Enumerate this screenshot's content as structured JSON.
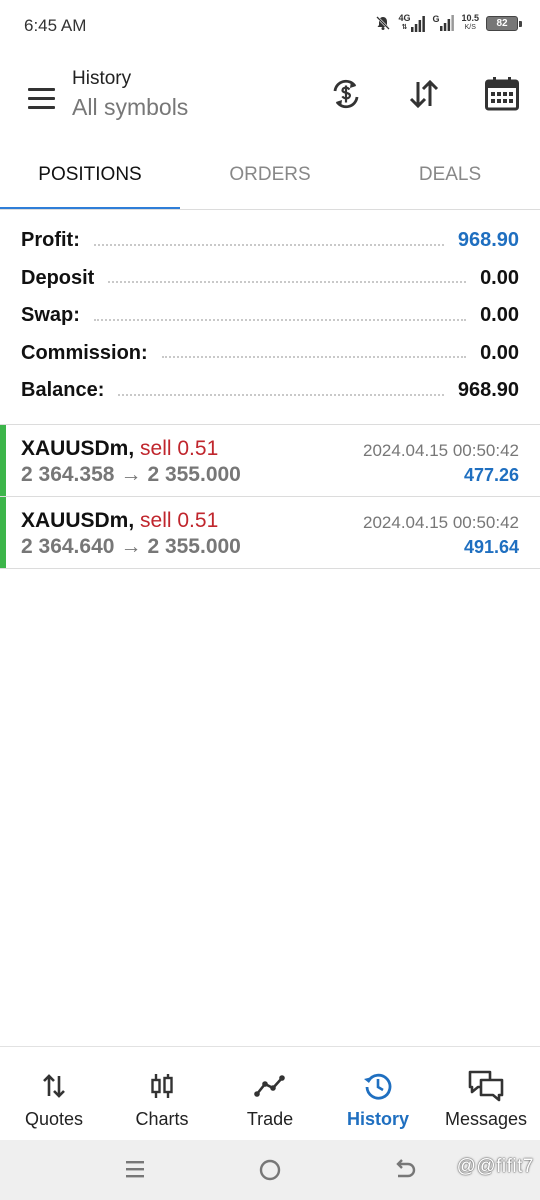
{
  "status_bar": {
    "time": "6:45 AM",
    "net1_top": "4G",
    "net1_bottom": "⇅",
    "net2": "G",
    "speed_value": "10.5",
    "speed_unit": "K/S",
    "battery": "82"
  },
  "header": {
    "title": "History",
    "subtitle": "All symbols",
    "menu_icon": "hamburger-menu-icon",
    "actions": [
      "currency-exchange-icon",
      "sort-icon",
      "calendar-icon"
    ]
  },
  "tabs": [
    {
      "label": "POSITIONS",
      "active": true
    },
    {
      "label": "ORDERS",
      "active": false
    },
    {
      "label": "DEALS",
      "active": false
    }
  ],
  "summary": [
    {
      "label": "Profit:",
      "value": "968.90",
      "color": "#1f6fc0"
    },
    {
      "label": "Deposit",
      "value": "0.00",
      "color": "#111111"
    },
    {
      "label": "Swap:",
      "value": "0.00",
      "color": "#111111"
    },
    {
      "label": "Commission:",
      "value": "0.00",
      "color": "#111111"
    },
    {
      "label": "Balance:",
      "value": "968.90",
      "color": "#111111"
    }
  ],
  "deals": [
    {
      "symbol": "XAUUSDm",
      "side": "sell 0.51",
      "open_price": "2 364.358",
      "arrow": "→",
      "close_price": "2 355.000",
      "time": "2024.04.15 00:50:42",
      "profit": "477.26"
    },
    {
      "symbol": "XAUUSDm",
      "side": "sell 0.51",
      "open_price": "2 364.640",
      "arrow": "→",
      "close_price": "2 355.000",
      "time": "2024.04.15 00:50:42",
      "profit": "491.64"
    }
  ],
  "colors": {
    "accent": "#1f6fc0",
    "tab_indicator": "#2f7ed8",
    "sell": "#c0262d",
    "profit_bar": "#3cb54a"
  },
  "bottom_nav": [
    {
      "label": "Quotes",
      "icon": "quotes-arrows-icon",
      "active": false
    },
    {
      "label": "Charts",
      "icon": "candlestick-chart-icon",
      "active": false
    },
    {
      "label": "Trade",
      "icon": "trade-line-icon",
      "active": false
    },
    {
      "label": "History",
      "icon": "history-clock-icon",
      "active": true
    },
    {
      "label": "Messages",
      "icon": "messages-chat-icon",
      "active": false
    }
  ],
  "system_nav": {
    "watermark": "@@fifit7"
  }
}
